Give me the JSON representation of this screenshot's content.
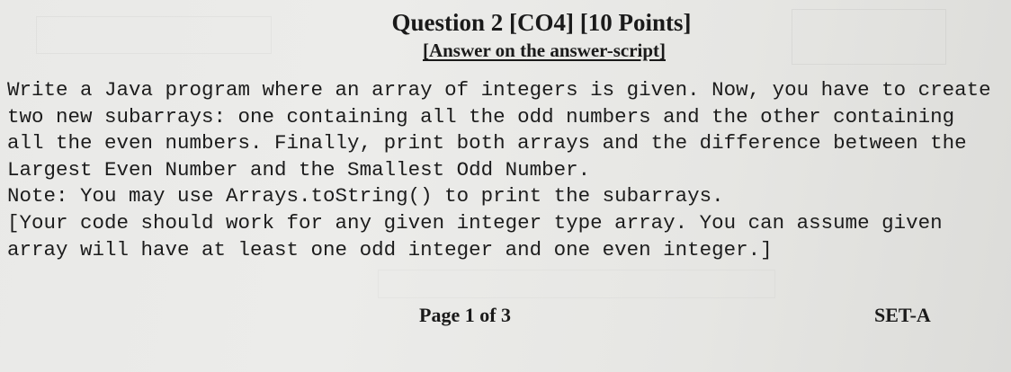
{
  "header": {
    "title": "Question 2 [CO4] [10 Points]",
    "subtitle": "[Answer on the answer-script]"
  },
  "question": {
    "lines": [
      "Write a Java program where an array of integers is given. Now, you have to create",
      "two new subarrays: one containing all the odd numbers and the other containing",
      "all the even numbers. Finally, print both arrays and the difference between the",
      "Largest Even Number and the Smallest Odd Number.",
      "Note: You may use Arrays.toString() to print the subarrays.",
      "[Your code should work for any given integer type array. You can assume given",
      "array will have at least one odd integer and one even integer.]"
    ]
  },
  "footer": {
    "page": "Page 1 of 3",
    "set": "SET-A"
  }
}
